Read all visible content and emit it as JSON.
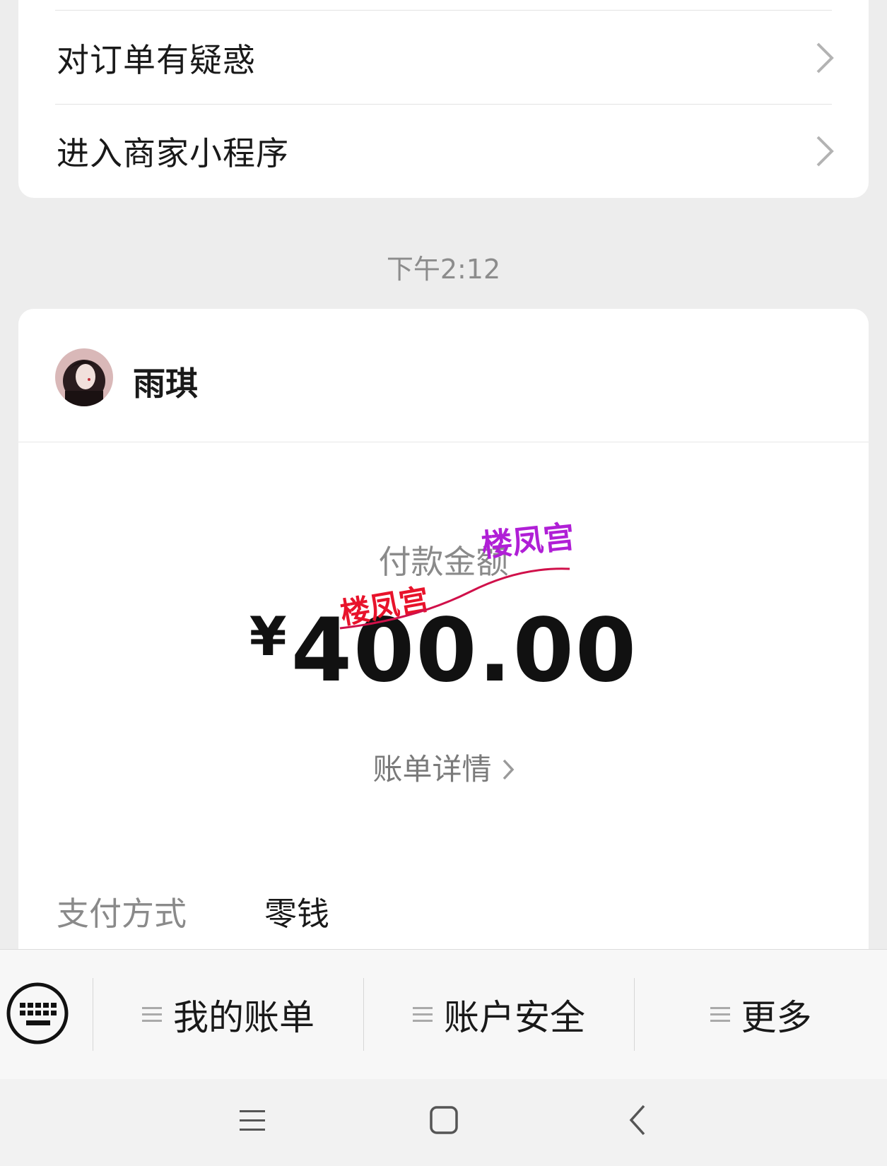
{
  "menu": {
    "items": [
      {
        "label": "对订单有疑惑"
      },
      {
        "label": "进入商家小程序"
      }
    ]
  },
  "timestamp": "下午2:12",
  "payment": {
    "payee_name": "雨琪",
    "amount_label": "付款金额",
    "currency_symbol": "¥",
    "amount": "400.00",
    "bill_details_link": "账单详情",
    "method_label": "支付方式",
    "method_value": "零钱"
  },
  "watermark": {
    "text": "楼凤宫"
  },
  "bottom_menu": {
    "items": [
      {
        "label": "我的账单",
        "icon": "menu-lines-icon"
      },
      {
        "label": "账户安全",
        "icon": "menu-lines-icon"
      },
      {
        "label": "更多",
        "icon": "menu-lines-icon"
      }
    ],
    "keyboard_icon": "keyboard-icon"
  },
  "system_nav": {
    "icons": [
      "menu-icon",
      "home-icon",
      "back-icon"
    ]
  },
  "colors": {
    "background": "#ededed",
    "card": "#ffffff",
    "watermark_red": "#e8132b",
    "watermark_purple": "#b01fd6"
  }
}
